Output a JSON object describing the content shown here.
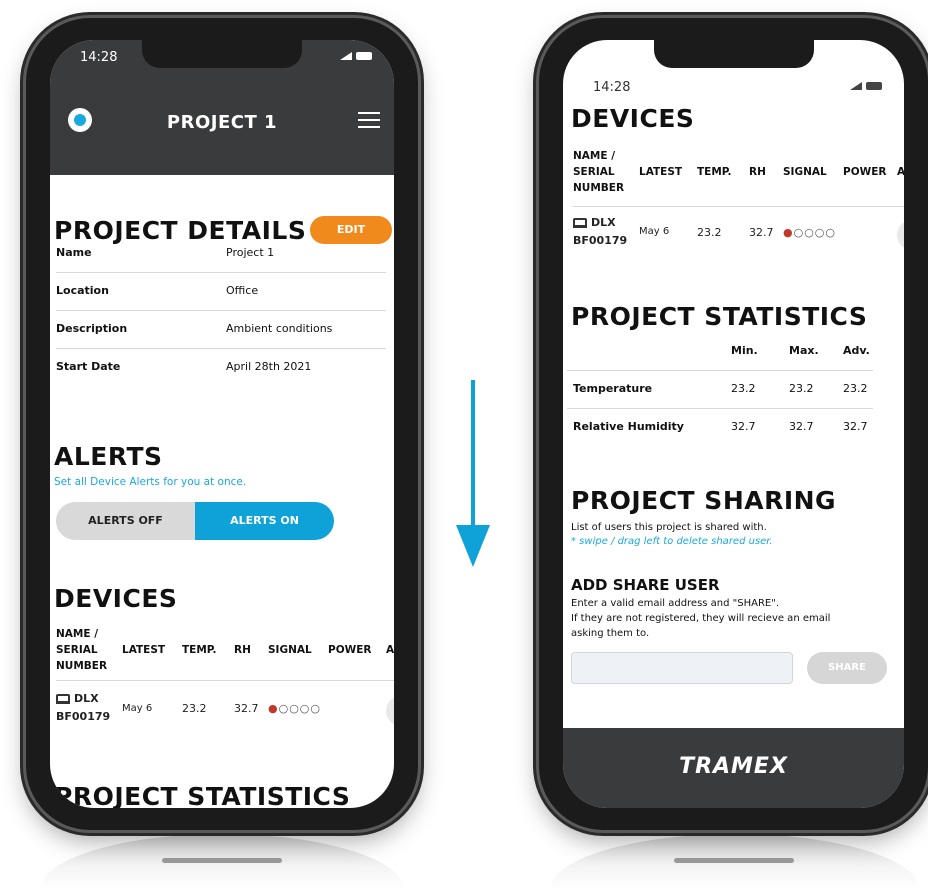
{
  "left": {
    "status_time": "14:28",
    "header_title": "PROJECT 1",
    "details_heading": "PROJECT DETAILS",
    "edit_label": "EDIT",
    "details": [
      {
        "label": "Name",
        "value": "Project 1"
      },
      {
        "label": "Location",
        "value": "Office"
      },
      {
        "label": "Description",
        "value": "Ambient conditions"
      },
      {
        "label": "Start Date",
        "value": "April 28th 2021"
      }
    ],
    "alerts_heading": "ALERTS",
    "alerts_sub": "Set all Device Alerts for you at once.",
    "alerts_off": "ALERTS OFF",
    "alerts_on": "ALERTS ON",
    "devices_heading": "DEVICES",
    "stats_heading": "PROJECT STATISTICS"
  },
  "devices_table": {
    "headers": [
      "NAME /",
      "SERIAL",
      "NUMBER",
      "LATEST",
      "TEMP.",
      "RH",
      "SIGNAL",
      "POWER",
      "A"
    ],
    "row": {
      "name": "DLX",
      "serial": "BF00179",
      "latest": "May 6",
      "temp": "23.2",
      "rh": "32.7",
      "signal_filled": 1,
      "signal_total": 5
    }
  },
  "right": {
    "status_time": "14:28",
    "devices_heading": "DEVICES",
    "stats_heading": "PROJECT STATISTICS",
    "stats_cols": [
      "Min.",
      "Max.",
      "Adv."
    ],
    "stats_rows": [
      {
        "label": "Temperature",
        "min": "23.2",
        "max": "23.2",
        "adv": "23.2"
      },
      {
        "label": "Relative Humidity",
        "min": "32.7",
        "max": "32.7",
        "adv": "32.7"
      }
    ],
    "sharing_heading": "PROJECT SHARING",
    "sharing_text": "List of users this project is shared with.",
    "sharing_hint": "* swipe / drag left to delete shared user.",
    "add_share_heading": "ADD SHARE USER",
    "add_share_line1": "Enter a valid email address and \"SHARE\".",
    "add_share_line2": "If they are not registered, they will recieve an email",
    "add_share_line3": "asking them to.",
    "share_label": "SHARE",
    "footer_logo": "TRAMEX"
  },
  "colors": {
    "accent": "#0fa2d8",
    "edit": "#f08a1c",
    "header": "#3a3b3c",
    "signal_red": "#c0392b"
  }
}
